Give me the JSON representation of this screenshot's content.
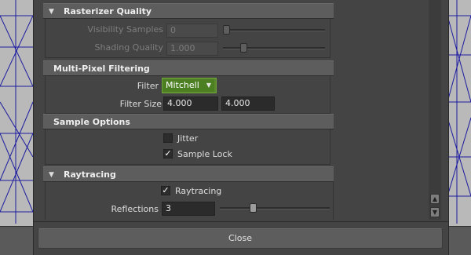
{
  "sections": {
    "rasterizer": {
      "title": "Rasterizer Quality",
      "visibility_label": "Visibility Samples",
      "visibility_value": "0",
      "visibility_level": 0.0,
      "shading_label": "Shading Quality",
      "shading_value": "1.000",
      "shading_level": 0.2
    },
    "multipixel": {
      "title": "Multi-Pixel Filtering",
      "filter_label": "Filter",
      "filter_value": "Mitchell",
      "filter_size_label": "Filter Size",
      "filter_size_x": "4.000",
      "filter_size_y": "4.000"
    },
    "sample_options": {
      "title": "Sample Options",
      "jitter_label": "Jitter",
      "jitter_checked": false,
      "sample_lock_label": "Sample Lock",
      "sample_lock_checked": true
    },
    "raytracing": {
      "title": "Raytracing",
      "raytracing_label": "Raytracing",
      "raytracing_checked": true,
      "reflections_label": "Reflections",
      "reflections_value": "3",
      "reflections_level": 0.3
    }
  },
  "close_label": "Close",
  "icons": {
    "expand": "triangle-down-icon",
    "check": "checkmark-icon",
    "dropdown": "chevron-down-icon"
  },
  "colors": {
    "accent": "#5a8a2c",
    "panel": "#444444",
    "header": "#5d5d5d"
  }
}
